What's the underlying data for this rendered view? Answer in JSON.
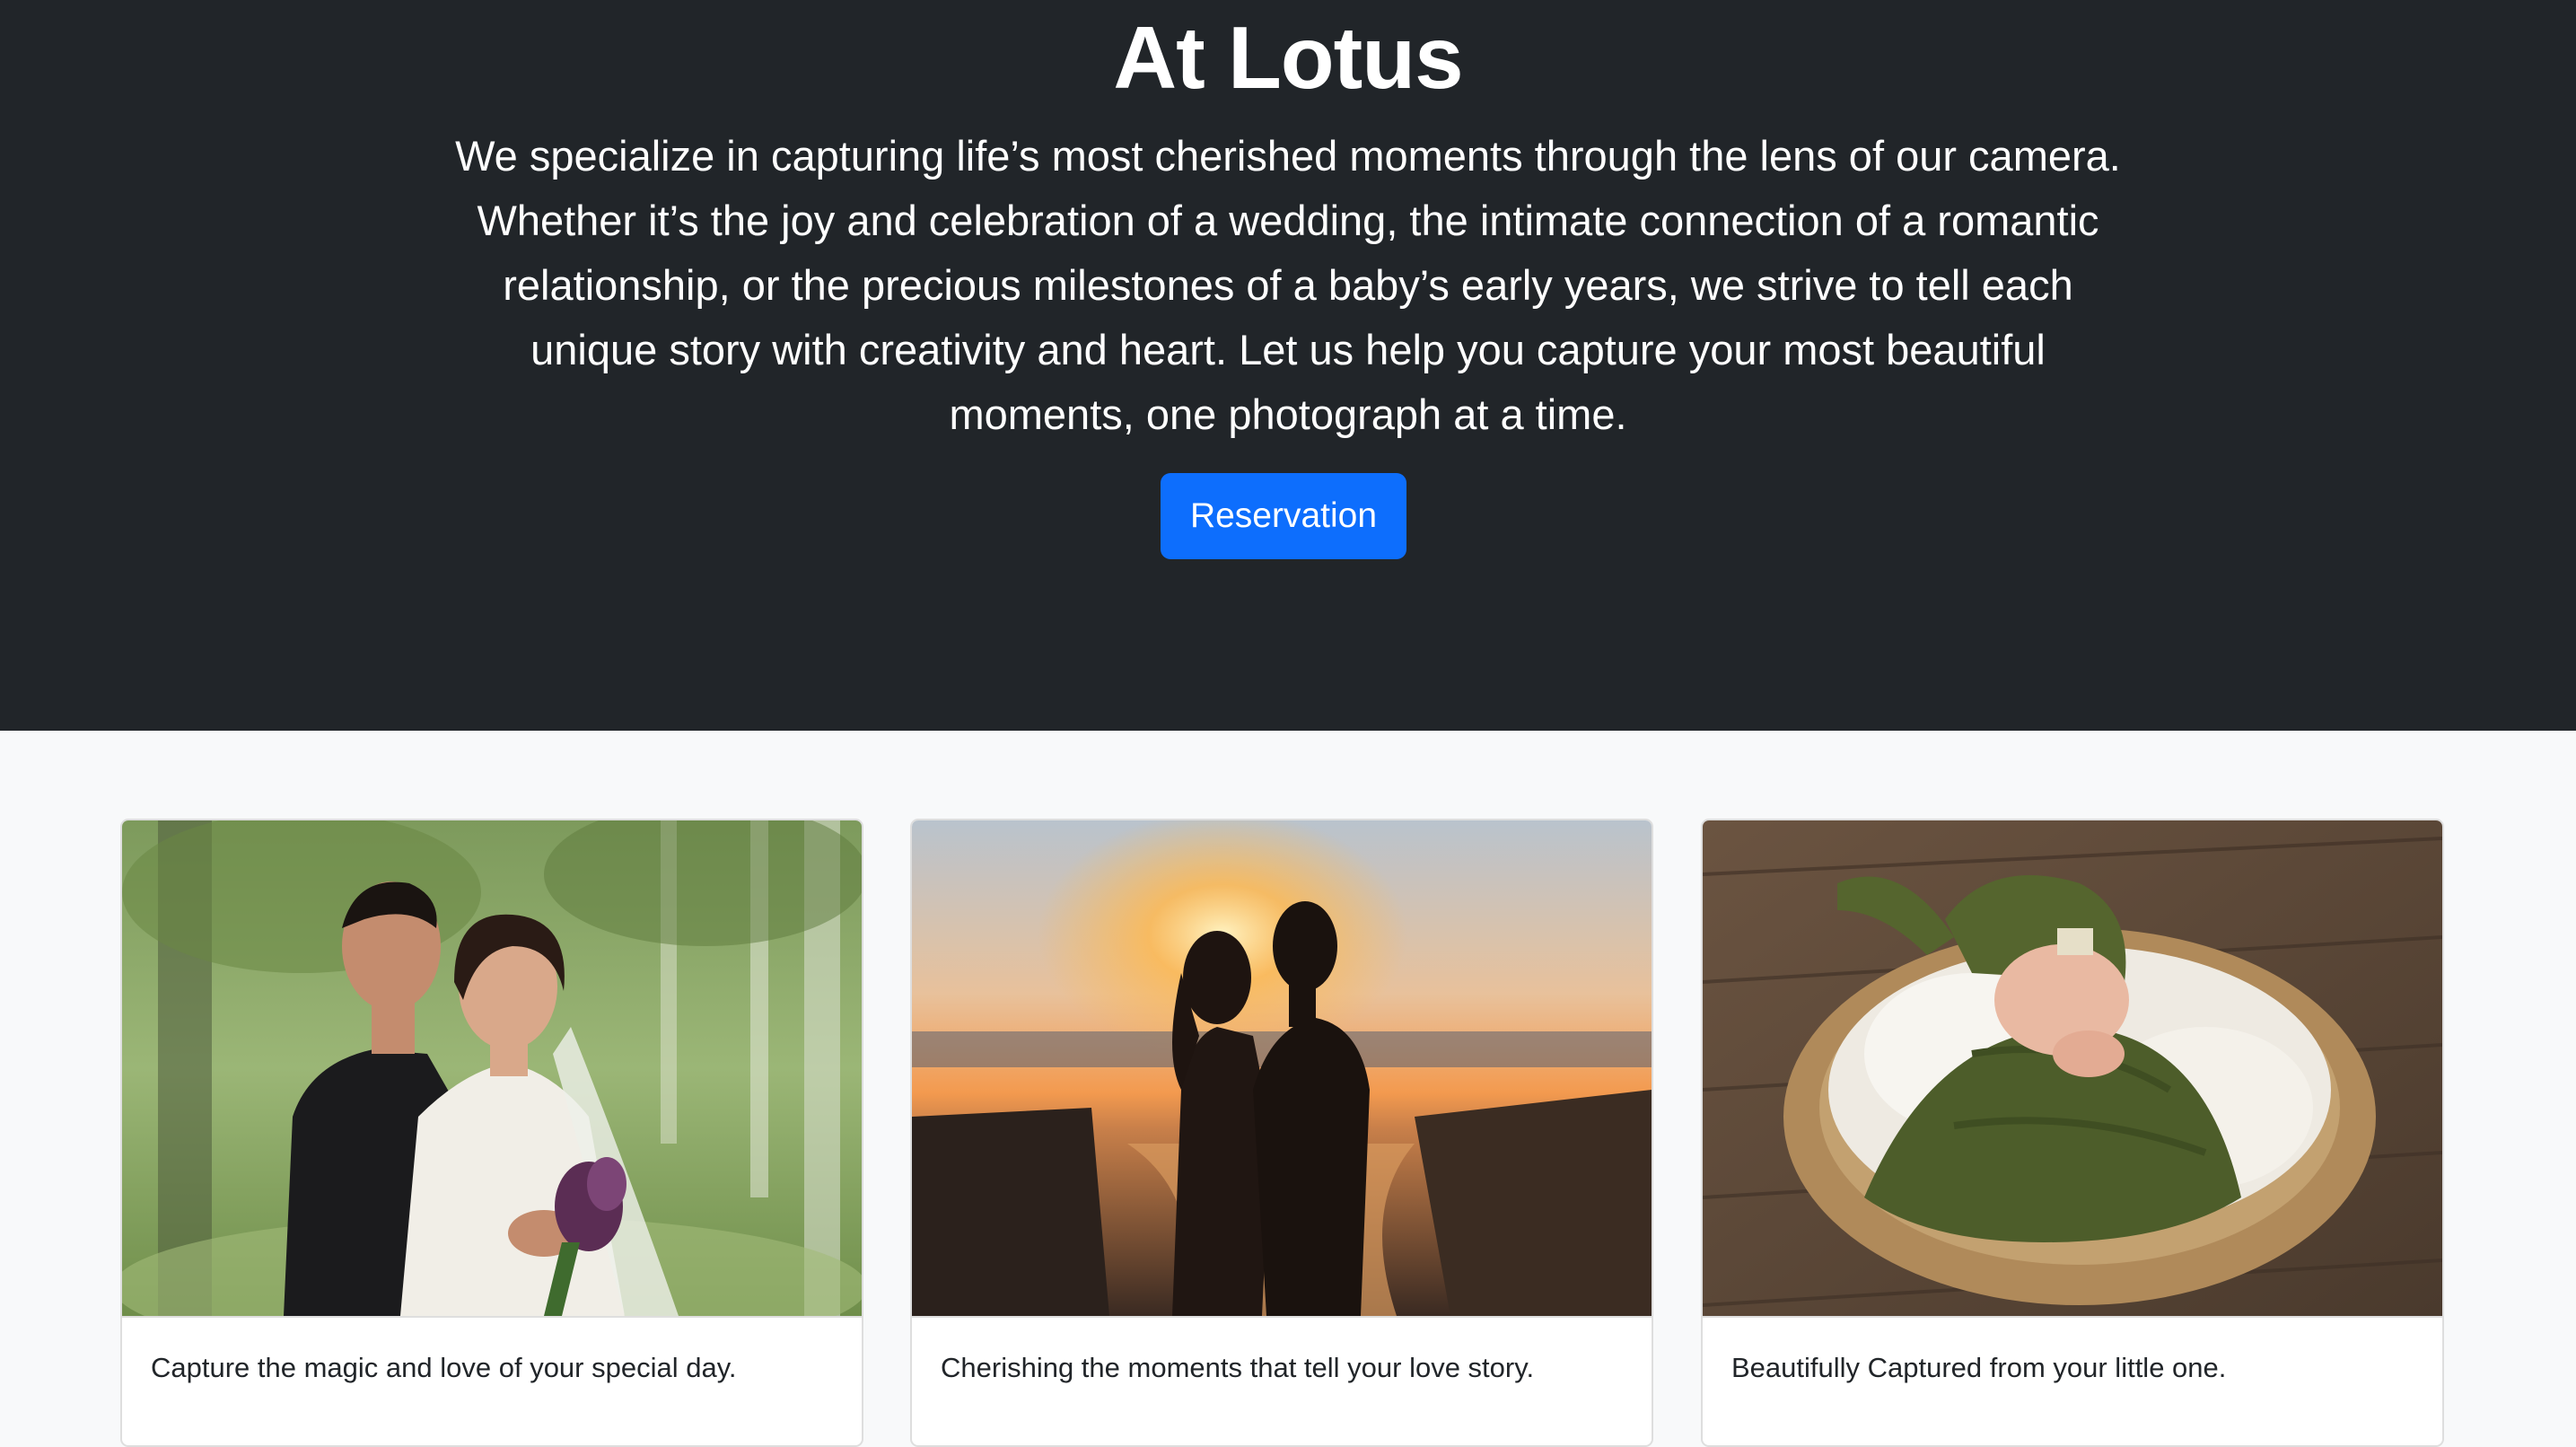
{
  "hero": {
    "title": "At Lotus",
    "description": "We specialize in capturing life’s most cherished moments through the lens of our camera. Whether it’s the joy and celebration of a wedding, the intimate connection of a romantic relationship, or the precious milestones of a baby’s early years, we strive to tell each unique story with creativity and heart. Let us help you capture your most beautiful moments, one photograph at a time.",
    "button_label": "Reservation"
  },
  "cards": [
    {
      "caption": "Capture the magic and love of your special day."
    },
    {
      "caption": "Cherishing the moments that tell your love story."
    },
    {
      "caption": "Beautifully Captured from your little one."
    }
  ],
  "colors": {
    "hero_bg": "#212529",
    "accent": "#0d6efd",
    "page_bg": "#f8f9fa"
  }
}
